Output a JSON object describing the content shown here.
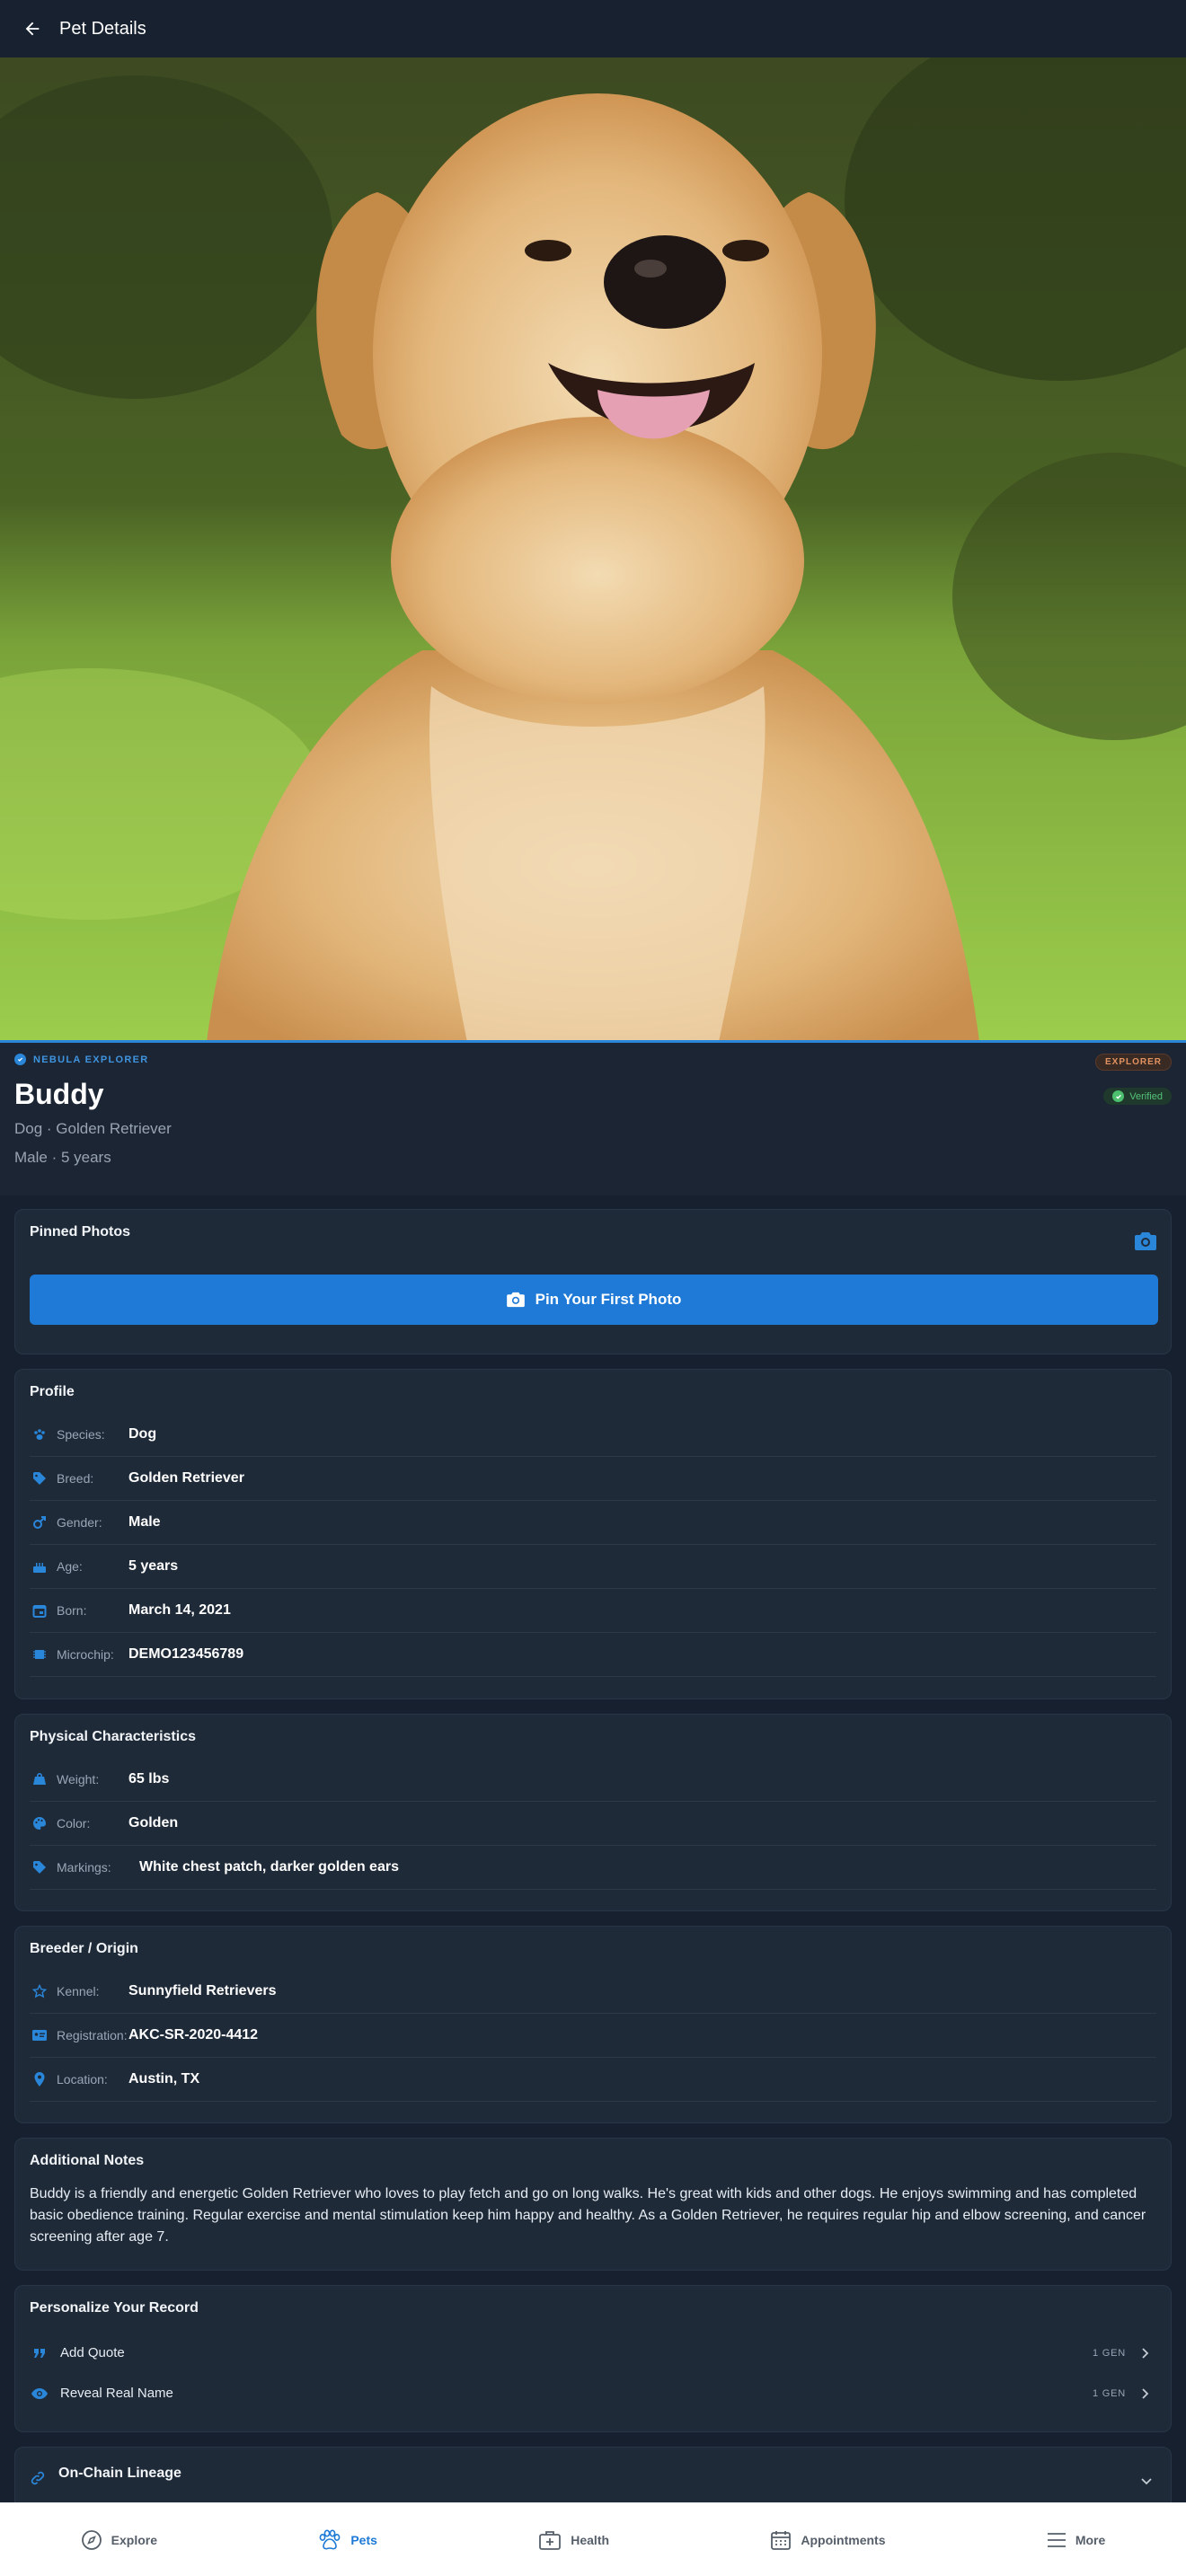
{
  "appbar": {
    "title": "Pet Details"
  },
  "hero": {
    "alt": "Golden Retriever portrait"
  },
  "identity": {
    "tier": "NEBULA EXPLORER",
    "tier_badge": "EXPLORER",
    "verified": "Verified",
    "name": "Buddy",
    "species_breed": "Dog · Golden Retriever",
    "gender_age": "Male · 5 years"
  },
  "pinned": {
    "title": "Pinned Photos",
    "button": "Pin Your First Photo"
  },
  "profile": {
    "title": "Profile",
    "rows": [
      {
        "label": "Species:",
        "value": "Dog",
        "icon": "paw-icon"
      },
      {
        "label": "Breed:",
        "value": "Golden Retriever",
        "icon": "tag-icon"
      },
      {
        "label": "Gender:",
        "value": "Male",
        "icon": "male-icon"
      },
      {
        "label": "Age:",
        "value": "5 years",
        "icon": "cake-icon"
      },
      {
        "label": "Born:",
        "value": "March 14, 2021",
        "icon": "calendar-icon"
      },
      {
        "label": "Microchip:",
        "value": "DEMO123456789",
        "icon": "chip-icon"
      }
    ]
  },
  "physical": {
    "title": "Physical Characteristics",
    "rows": [
      {
        "label": "Weight:",
        "value": "65 lbs",
        "icon": "scale-icon"
      },
      {
        "label": "Color:",
        "value": "Golden",
        "icon": "palette-icon"
      },
      {
        "label": "Markings:",
        "value": "White chest patch, darker golden ears",
        "icon": "tag-icon"
      }
    ]
  },
  "breeder": {
    "title": "Breeder / Origin",
    "rows": [
      {
        "label": "Kennel:",
        "value": "Sunnyfield Retrievers",
        "icon": "star-outline-icon"
      },
      {
        "label": "Registration:",
        "value": "AKC-SR-2020-4412",
        "icon": "id-card-icon"
      },
      {
        "label": "Location:",
        "value": "Austin, TX",
        "icon": "location-pin-icon"
      }
    ]
  },
  "notes": {
    "title": "Additional Notes",
    "text": "Buddy is a friendly and energetic Golden Retriever who loves to play fetch and go on long walks. He's great with kids and other dogs. He enjoys swimming and has completed basic obedience training. Regular exercise and mental stimulation keep him happy and healthy. As a Golden Retriever, he requires regular hip and elbow screening, and cancer screening after age 7."
  },
  "personalize": {
    "title": "Personalize Your Record",
    "items": [
      {
        "label": "Add Quote",
        "cost": "1 GEN"
      },
      {
        "label": "Reveal Real Name",
        "cost": "1 GEN"
      }
    ]
  },
  "lineage": {
    "title": "On-Chain Lineage"
  },
  "nav": {
    "items": [
      {
        "label": "Explore"
      },
      {
        "label": "Pets"
      },
      {
        "label": "Health"
      },
      {
        "label": "Appointments"
      },
      {
        "label": "More"
      }
    ]
  },
  "colors": {
    "accent": "#1e7ad6",
    "background": "#16202e",
    "card": "#1f2a39",
    "verified": "#4cc06e",
    "explorer": "#e09260"
  }
}
